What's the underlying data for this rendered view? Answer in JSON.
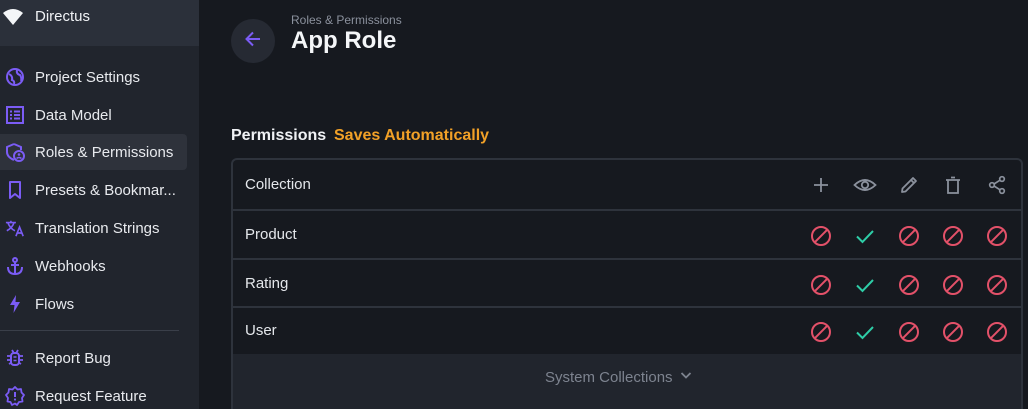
{
  "sidebar": {
    "project_name": "Directus",
    "items": [
      {
        "label": "Project Settings",
        "icon": "globe-icon"
      },
      {
        "label": "Data Model",
        "icon": "list-alt-icon"
      },
      {
        "label": "Roles & Permissions",
        "icon": "admin-panel-icon",
        "active": true
      },
      {
        "label": "Presets & Bookmar...",
        "icon": "bookmark-icon"
      },
      {
        "label": "Translation Strings",
        "icon": "translate-icon"
      },
      {
        "label": "Webhooks",
        "icon": "anchor-icon"
      },
      {
        "label": "Flows",
        "icon": "bolt-icon"
      }
    ],
    "footer_items": [
      {
        "label": "Report Bug",
        "icon": "bug-icon"
      },
      {
        "label": "Request Feature",
        "icon": "new-releases-icon"
      }
    ]
  },
  "header": {
    "breadcrumb": "Roles & Permissions",
    "title": "App Role"
  },
  "permissions": {
    "heading": "Permissions",
    "status": "Saves Automatically",
    "column_header": "Collection",
    "actions": [
      "create-icon",
      "read-icon",
      "update-icon",
      "delete-icon",
      "share-icon"
    ],
    "rows": [
      {
        "name": "Product",
        "values": [
          "none",
          "all",
          "none",
          "none",
          "none"
        ]
      },
      {
        "name": "Rating",
        "values": [
          "none",
          "all",
          "none",
          "none",
          "none"
        ]
      },
      {
        "name": "User",
        "values": [
          "none",
          "all",
          "none",
          "none",
          "none"
        ]
      }
    ],
    "system_collections_label": "System Collections"
  },
  "colors": {
    "accent": "#6644ff",
    "nav_icon": "#7b5cf5",
    "status": "#f2a127",
    "denied": "#e35169",
    "allowed": "#2ecda7",
    "header_icon": "#8b919d"
  }
}
